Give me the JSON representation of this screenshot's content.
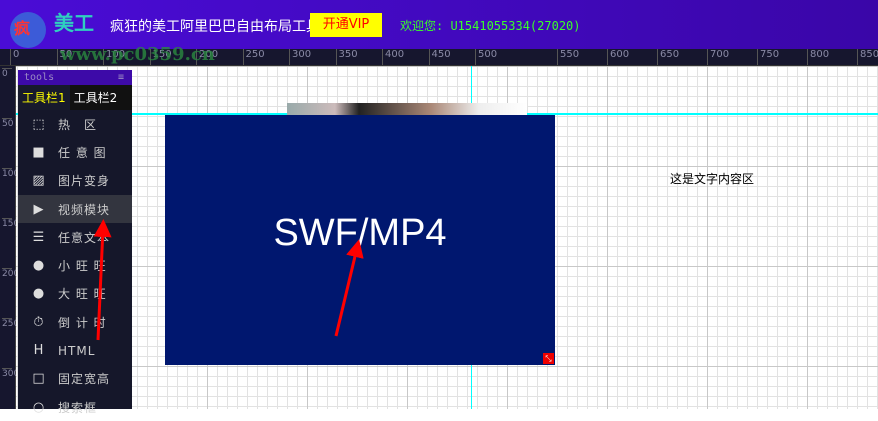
{
  "header": {
    "logo_text": "疯狂的美工",
    "app_title": "疯狂的美工阿里巴巴自由布局工具",
    "vip_button": "开通VIP",
    "welcome": "欢迎您: U1541055334(27020)",
    "watermark": "www.pc0359.cn"
  },
  "ruler": {
    "top": [
      "0",
      "50",
      "100",
      "150",
      "200",
      "250",
      "300",
      "350",
      "400",
      "450",
      "500",
      "550",
      "600",
      "650",
      "700",
      "750",
      "800",
      "850"
    ],
    "left": [
      "0",
      "50",
      "100",
      "150",
      "200",
      "250",
      "300"
    ]
  },
  "sidebar": {
    "title": "tools",
    "menu_icon": "≡",
    "tabs": [
      "工具栏1",
      "工具栏2"
    ],
    "items": [
      {
        "label": "热　区",
        "icon": "hotspot-icon"
      },
      {
        "label": "任 意 图",
        "icon": "image-block-icon"
      },
      {
        "label": "图片变身",
        "icon": "picture-icon"
      },
      {
        "label": "视频模块",
        "icon": "play-icon"
      },
      {
        "label": "任意文本",
        "icon": "text-icon"
      },
      {
        "label": "小 旺 旺",
        "icon": "wangwang-icon"
      },
      {
        "label": "大 旺 旺",
        "icon": "wangwang-icon"
      },
      {
        "label": "倒 计 时",
        "icon": "stopwatch-icon"
      },
      {
        "label": "HTML",
        "icon": "html-icon"
      },
      {
        "label": "固定宽高",
        "icon": "square-icon"
      },
      {
        "label": "搜索框",
        "icon": "search-icon"
      }
    ]
  },
  "canvas": {
    "video_label": "SWF/MP4",
    "text_block": "这是文字内容区"
  },
  "colors": {
    "header": "#4a0cd6",
    "vip_bg": "#ffff00",
    "video_bg": "#00176f",
    "guide": "#00ffff",
    "arrow": "#ff0000"
  }
}
